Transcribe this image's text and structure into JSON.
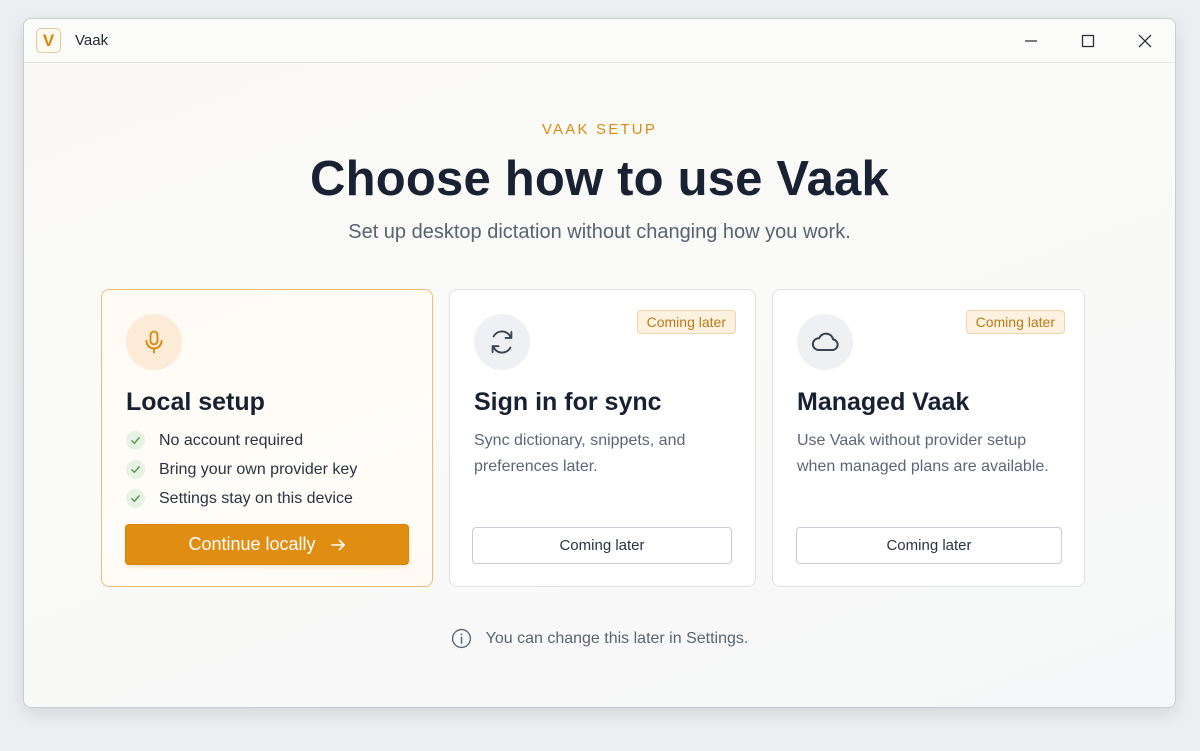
{
  "window": {
    "app_logo_letter": "V",
    "title": "Vaak"
  },
  "header": {
    "kicker": "VAAK SETUP",
    "heading": "Choose how to use Vaak",
    "subheading": "Set up desktop dictation without changing how you work."
  },
  "cards": {
    "local": {
      "title": "Local setup",
      "features": [
        "No account required",
        "Bring your own provider key",
        "Settings stay on this device"
      ],
      "button_label": "Continue locally",
      "button_icon": "arrow-right-icon",
      "icon": "microphone-icon"
    },
    "sync": {
      "badge": "Coming later",
      "title": "Sign in for sync",
      "description": "Sync dictionary, snippets, and preferences later.",
      "button_label": "Coming later",
      "icon": "sync-icon"
    },
    "managed": {
      "badge": "Coming later",
      "title": "Managed Vaak",
      "description": "Use Vaak without provider setup when managed plans are available.",
      "button_label": "Coming later",
      "icon": "cloud-icon"
    }
  },
  "footer": {
    "note": "You can change this later in Settings.",
    "icon": "info-icon"
  },
  "colors": {
    "accent": "#e08e12",
    "kicker": "#d98b14",
    "badge_bg": "#fdf1df",
    "check_green": "#5a9a4c"
  }
}
